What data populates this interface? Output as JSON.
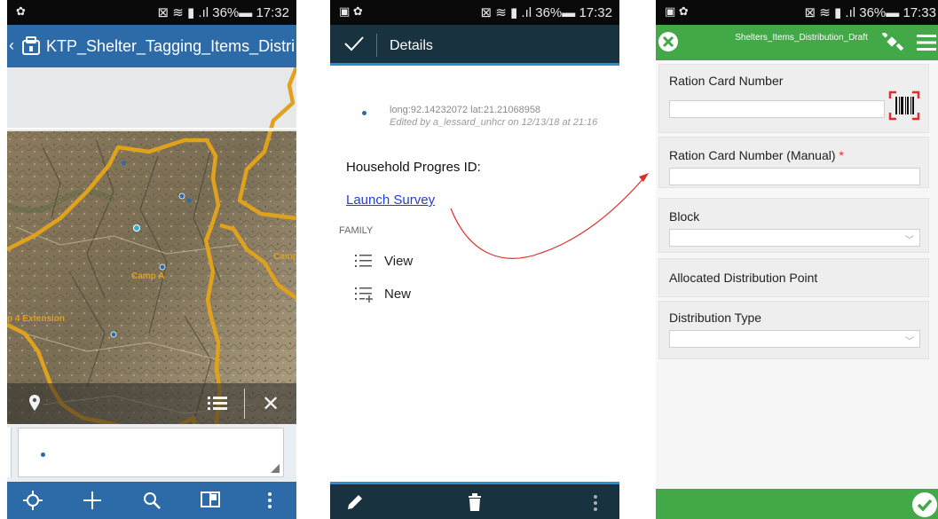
{
  "status_bars": {
    "screen1_time": "17:32",
    "screen2_time": "17:32",
    "screen3_time": "17:33",
    "battery": "36%"
  },
  "map_screen": {
    "title": "KTP_Shelter_Tagging_Items_Distrib...",
    "map_labels": {
      "camp_a": "Camp A",
      "camp_partial": "Camp",
      "extension_partial": "p 4 Extension"
    },
    "bottom_icons": [
      "locate-icon",
      "add-icon",
      "search-icon",
      "map-icon",
      "overflow-icon"
    ],
    "colors": {
      "bar": "#2c6aa8",
      "boundary": "#e0a21c"
    }
  },
  "details_screen": {
    "title": "Details",
    "coordinates": "long:92.14232072 lat:21.21068958",
    "edited": "Edited by a_lessard_unhcr on 12/13/18 at 21:16",
    "household_label": "Household Progres ID:",
    "launch_survey": "Launch Survey",
    "family_section": "FAMILY",
    "view_label": "View",
    "new_label": "New",
    "bottom_icons": [
      "edit-icon",
      "delete-icon",
      "overflow-icon"
    ],
    "colors": {
      "bar": "#18323f",
      "accent": "#2a8fd0",
      "link": "#1f3fd6"
    }
  },
  "form_screen": {
    "title": "Shelters_Items_Distribution_Draft",
    "fields": {
      "ration_card": {
        "label": "Ration Card Number",
        "value": ""
      },
      "ration_card_manual": {
        "label": "Ration Card Number (Manual)",
        "required_mark": "*",
        "value": ""
      },
      "block": {
        "label": "Block",
        "value": ""
      },
      "allocated_point": {
        "label": "Allocated Distribution Point"
      },
      "distribution_type": {
        "label": "Distribution Type",
        "value": ""
      }
    },
    "colors": {
      "bar": "#42a848",
      "required": "#d9302a"
    }
  }
}
